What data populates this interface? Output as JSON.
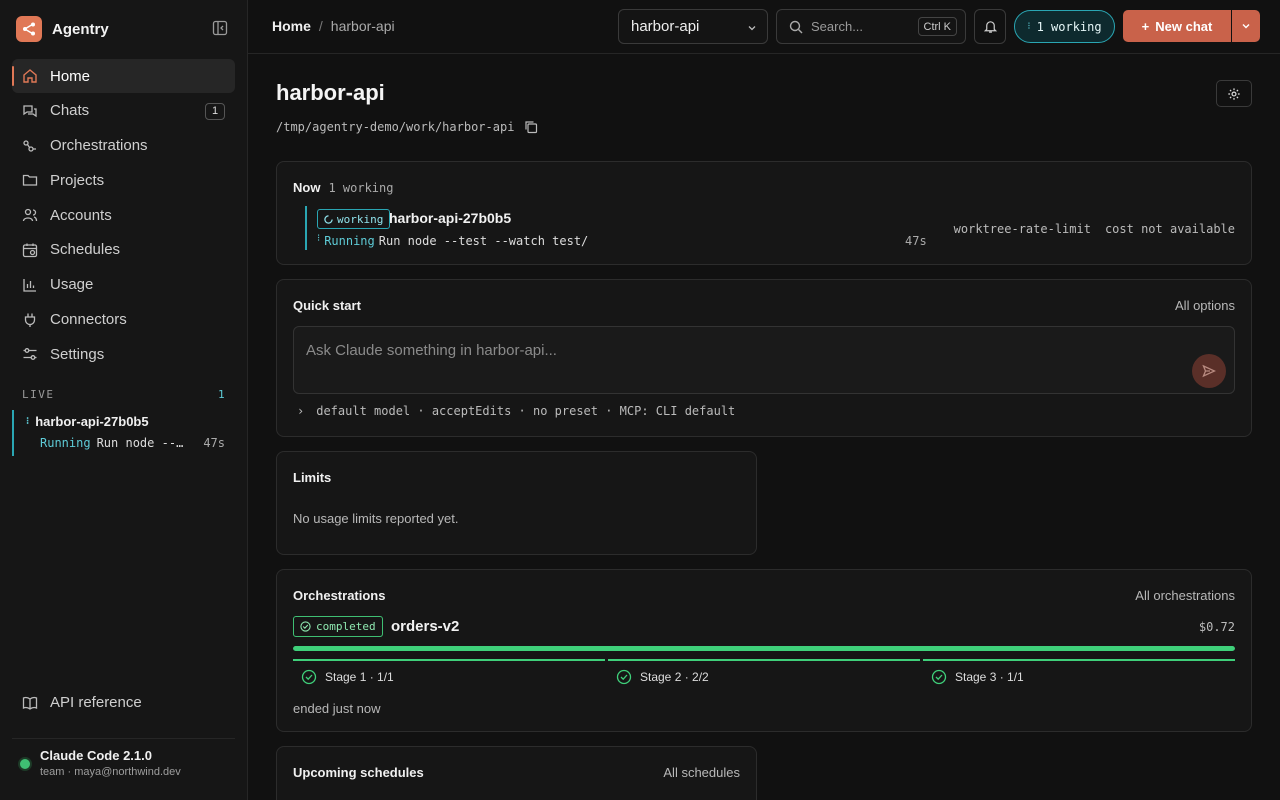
{
  "sidebar": {
    "brand": "Agentry",
    "nav": [
      {
        "label": "Home",
        "icon": "home-icon"
      },
      {
        "label": "Chats",
        "icon": "chat-icon",
        "badge": "1"
      },
      {
        "label": "Orchestrations",
        "icon": "orchestration-icon"
      },
      {
        "label": "Projects",
        "icon": "folder-icon"
      },
      {
        "label": "Accounts",
        "icon": "users-icon"
      },
      {
        "label": "Schedules",
        "icon": "calendar-icon"
      },
      {
        "label": "Usage",
        "icon": "bar-chart-icon"
      },
      {
        "label": "Connectors",
        "icon": "plug-icon"
      },
      {
        "label": "Settings",
        "icon": "sliders-icon"
      }
    ],
    "live": {
      "label": "LIVE",
      "count": "1",
      "item": {
        "title": "harbor-api-27b0b5",
        "status": "Running",
        "command": "Run node --test --watch test/",
        "time": "47s"
      }
    },
    "api_reference": "API reference",
    "account": {
      "name": "Claude Code 2.1.0",
      "sub": "team · maya@northwind.dev",
      "status_color": "#3fbf73"
    }
  },
  "topbar": {
    "breadcrumb": {
      "home": "Home",
      "separator": "/",
      "current": "harbor-api"
    },
    "project_select": "harbor-api",
    "search": {
      "placeholder": "Search...",
      "shortcut": "Ctrl K"
    },
    "working_pill": "1 working",
    "new_chat": "New chat"
  },
  "page": {
    "title": "harbor-api",
    "path": "/tmp/agentry-demo/work/harbor-api"
  },
  "now": {
    "title": "Now",
    "count": "1 working",
    "item": {
      "badge": "working",
      "name": "harbor-api-27b0b5",
      "status": "Running",
      "command": "Run node --test --watch test/",
      "time": "47s",
      "worktree": "worktree-rate-limit",
      "cost": "cost not available"
    }
  },
  "quick_start": {
    "title": "Quick start",
    "link": "All options",
    "placeholder": "Ask Claude something in harbor-api...",
    "options": "default model · acceptEdits · no preset · MCP: CLI default"
  },
  "limits": {
    "title": "Limits",
    "text": "No usage limits reported yet."
  },
  "orchestrations": {
    "title": "Orchestrations",
    "link": "All orchestrations",
    "item": {
      "badge": "completed",
      "name": "orders-v2",
      "cost": "$0.72",
      "progress": 1.0,
      "stages": [
        "Stage 1 · 1/1",
        "Stage 2 · 2/2",
        "Stage 3 · 1/1"
      ],
      "ended": "ended just now"
    }
  },
  "schedules": {
    "title": "Upcoming schedules",
    "link": "All schedules"
  },
  "colors": {
    "accent": "#e07856",
    "working": "#2aa6b3",
    "success": "#3fd07a"
  }
}
